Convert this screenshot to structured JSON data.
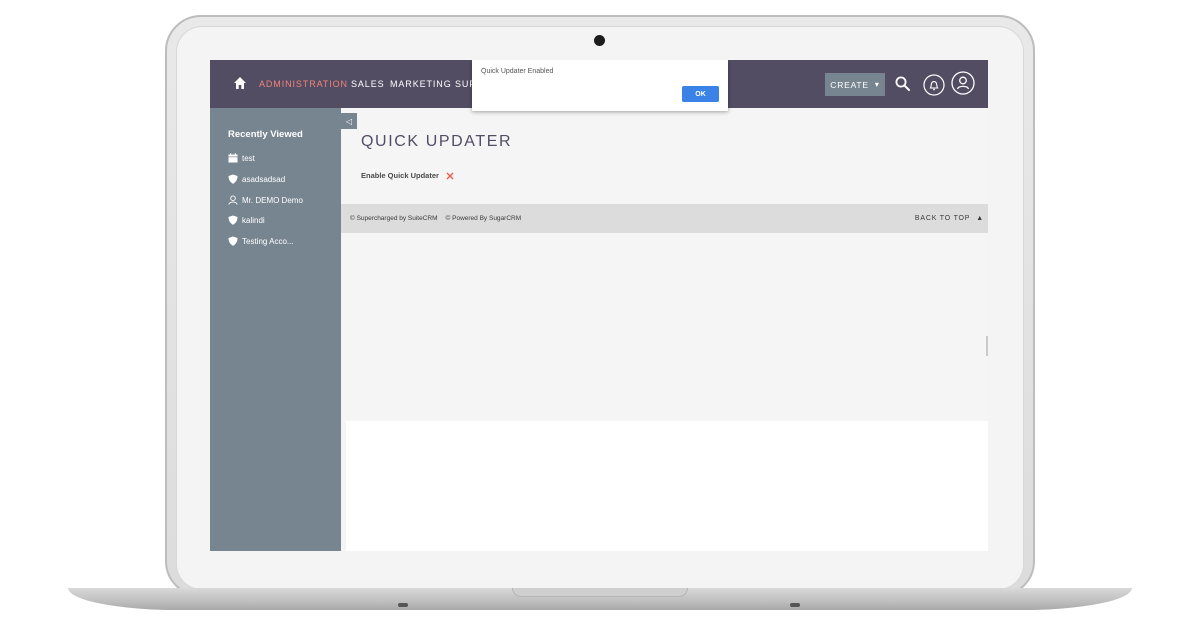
{
  "nav": {
    "items": [
      "ADMINISTRATION",
      "SALES",
      "MARKETING",
      "SUP"
    ],
    "active_index": 0,
    "create_label": "CREATE",
    "create_caret": "▾"
  },
  "sidebar": {
    "title": "Recently Viewed",
    "items": [
      {
        "label": "test",
        "icon": "calendar-icon"
      },
      {
        "label": "asadsadsad",
        "icon": "shield-icon"
      },
      {
        "label": "Mr. DEMO Demo",
        "icon": "person-icon"
      },
      {
        "label": "kalindi",
        "icon": "shield-icon"
      },
      {
        "label": "Testing Acco...",
        "icon": "shield-icon"
      }
    ]
  },
  "main": {
    "page_title": "QUICK UPDATER",
    "field_label": "Enable Quick Updater",
    "field_value_icon": "x-icon"
  },
  "footer": {
    "supercharged": "© Supercharged by SuiteCRM",
    "powered": "© Powered By SugarCRM",
    "back_to_top": "BACK TO TOP",
    "back_to_top_arrow": "▲"
  },
  "dialog": {
    "message": "Quick Updater Enabled",
    "ok_label": "OK"
  },
  "colors": {
    "nav_bg": "#534d64",
    "nav_active": "#f08377",
    "sidebar_bg": "#778591",
    "ok_button": "#3b82e8",
    "x_icon": "#e45a4a"
  }
}
